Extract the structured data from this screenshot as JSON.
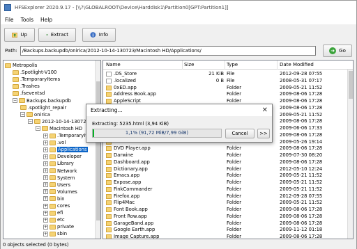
{
  "window": {
    "title": "HFSExplorer 2020.9.17 - [\\\\?\\GLOBALROOT\\Device\\Harddisk1\\Partition0[GPT:Partition1]]"
  },
  "menu": [
    "File",
    "Tools",
    "Help"
  ],
  "toolbar": {
    "up_label": "Up",
    "extract_label": "Extract",
    "info_label": "Info"
  },
  "path": {
    "label": "Path:",
    "value": "/Backups.backupdb/onirica/2012-10-14-130723/Macintosh HD/Applications/",
    "go_label": "Go"
  },
  "tree": [
    {
      "label": "Metropolis",
      "indent": 0,
      "exp": ""
    },
    {
      "label": ".Spotlight-V100",
      "indent": 1,
      "exp": ""
    },
    {
      "label": ".TemporaryItems",
      "indent": 1,
      "exp": ""
    },
    {
      "label": ".Trashes",
      "indent": 1,
      "exp": ""
    },
    {
      "label": ".fseventsd",
      "indent": 1,
      "exp": ""
    },
    {
      "label": "Backups.backupdb",
      "indent": 1,
      "exp": "−"
    },
    {
      "label": ".spotlight_repair",
      "indent": 2,
      "exp": ""
    },
    {
      "label": "onirica",
      "indent": 2,
      "exp": "−"
    },
    {
      "label": "2012-10-14-130723",
      "indent": 3,
      "exp": "−"
    },
    {
      "label": "Macintosh HD",
      "indent": 4,
      "exp": "−"
    },
    {
      "label": ".TemporaryItems",
      "indent": 5,
      "exp": "+"
    },
    {
      "label": ".vol",
      "indent": 5,
      "exp": "+"
    },
    {
      "label": "Applications",
      "indent": 5,
      "exp": "+",
      "selected": true
    },
    {
      "label": "Developer",
      "indent": 5,
      "exp": "+"
    },
    {
      "label": "Library",
      "indent": 5,
      "exp": "+"
    },
    {
      "label": "Network",
      "indent": 5,
      "exp": "+"
    },
    {
      "label": "System",
      "indent": 5,
      "exp": "+"
    },
    {
      "label": "Users",
      "indent": 5,
      "exp": "+"
    },
    {
      "label": "Volumes",
      "indent": 5,
      "exp": "+"
    },
    {
      "label": "bin",
      "indent": 5,
      "exp": "+"
    },
    {
      "label": "cores",
      "indent": 5,
      "exp": "+"
    },
    {
      "label": "efi",
      "indent": 5,
      "exp": "+"
    },
    {
      "label": "etc",
      "indent": 5,
      "exp": "+"
    },
    {
      "label": "private",
      "indent": 5,
      "exp": "+"
    },
    {
      "label": "sbin",
      "indent": 5,
      "exp": "+"
    }
  ],
  "list": {
    "headers": {
      "name": "Name",
      "size": "Size",
      "type": "Type",
      "date": "Date Modified"
    },
    "rows": [
      {
        "name": ".DS_Store",
        "size": "21 KiB",
        "type": "File",
        "date": "2012-09-28 07:55",
        "icon": "file"
      },
      {
        "name": ".localized",
        "size": "0 B",
        "type": "File",
        "date": "2008-05-31 07:17",
        "icon": "file"
      },
      {
        "name": "0xED.app",
        "size": "",
        "type": "Folder",
        "date": "2009-05-21 11:52",
        "icon": "folder"
      },
      {
        "name": "Address Book.app",
        "size": "",
        "type": "Folder",
        "date": "2009-08-06 17:28",
        "icon": "folder"
      },
      {
        "name": "AppleScript",
        "size": "",
        "type": "Folder",
        "date": "2009-08-06 17:28",
        "icon": "folder"
      },
      {
        "name": "",
        "size": "",
        "type": "",
        "date": "2009-08-06 17:28",
        "icon": "folder"
      },
      {
        "name": "",
        "size": "",
        "type": "",
        "date": "2009-05-21 11:52",
        "icon": "folder"
      },
      {
        "name": "",
        "size": "",
        "type": "",
        "date": "2009-08-06 17:28",
        "icon": "folder"
      },
      {
        "name": "",
        "size": "",
        "type": "",
        "date": "2009-06-06 17:33",
        "icon": "folder"
      },
      {
        "name": "",
        "size": "",
        "type": "",
        "date": "2009-08-06 17:28",
        "icon": "folder"
      },
      {
        "name": "",
        "size": "",
        "type": "",
        "date": "2009-05-26 19:14",
        "icon": "folder"
      },
      {
        "name": "DVD Player.app",
        "size": "",
        "type": "Folder",
        "date": "2009-08-06 17:28",
        "icon": "folder"
      },
      {
        "name": "Darwine",
        "size": "",
        "type": "Folder",
        "date": "2009-07-30 08:20",
        "icon": "folder"
      },
      {
        "name": "Dashboard.app",
        "size": "",
        "type": "Folder",
        "date": "2009-08-06 17:28",
        "icon": "folder"
      },
      {
        "name": "Dictionary.app",
        "size": "",
        "type": "Folder",
        "date": "2012-05-10 12:24",
        "icon": "folder"
      },
      {
        "name": "Emacs.app",
        "size": "",
        "type": "Folder",
        "date": "2009-05-21 11:52",
        "icon": "folder"
      },
      {
        "name": "Expose.app",
        "size": "",
        "type": "Folder",
        "date": "2009-05-21 11:52",
        "icon": "folder"
      },
      {
        "name": "FinkCommander",
        "size": "",
        "type": "Folder",
        "date": "2009-05-21 11:52",
        "icon": "folder"
      },
      {
        "name": "Firefox.app",
        "size": "",
        "type": "Folder",
        "date": "2012-09-28 07:55",
        "icon": "folder"
      },
      {
        "name": "Flip4Mac",
        "size": "",
        "type": "Folder",
        "date": "2009-05-21 11:52",
        "icon": "folder"
      },
      {
        "name": "Font Book.app",
        "size": "",
        "type": "Folder",
        "date": "2009-08-06 17:28",
        "icon": "folder"
      },
      {
        "name": "Front Row.app",
        "size": "",
        "type": "Folder",
        "date": "2009-08-06 17:28",
        "icon": "folder"
      },
      {
        "name": "GarageBand.app",
        "size": "",
        "type": "Folder",
        "date": "2009-08-06 17:28",
        "icon": "folder"
      },
      {
        "name": "Google Earth.app",
        "size": "",
        "type": "Folder",
        "date": "2009-11-12 01:18",
        "icon": "folder"
      },
      {
        "name": "Image Capture.app",
        "size": "",
        "type": "Folder",
        "date": "2009-08-06 17:28",
        "icon": "folder"
      }
    ]
  },
  "status": "0 objects selected (0 bytes)",
  "dialog": {
    "title": "Extracting...",
    "status": "Extracting: 5235.html (3,94 KiB)",
    "progress_text": "1,1% (91,72 MiB/7,99 GiB)",
    "progress_fraction": 0.011,
    "cancel_label": "Cancel",
    "more_label": ">>"
  },
  "colors": {
    "selection": "#0a64c8",
    "progress_fill": "#06b025",
    "folder": "#f5d374"
  }
}
